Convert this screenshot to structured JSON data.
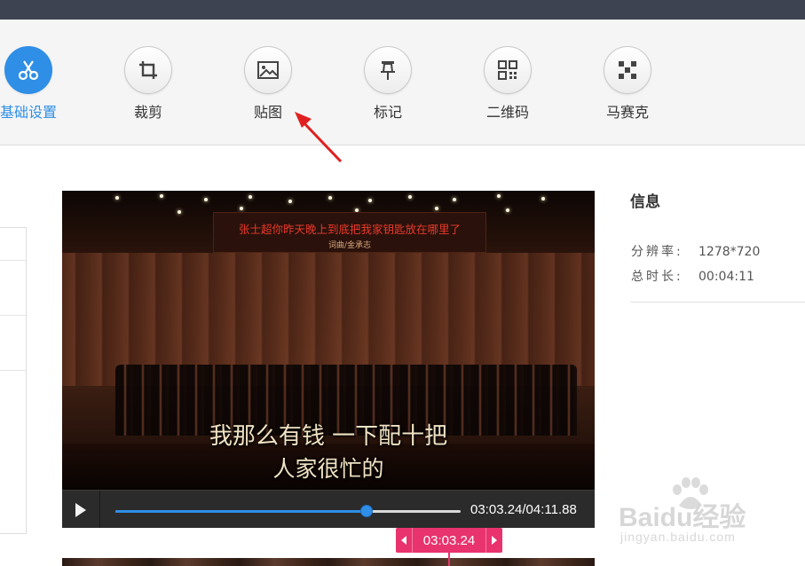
{
  "toolbar": {
    "tools": [
      {
        "label": "基础设置",
        "icon": "scissors-icon",
        "active": true
      },
      {
        "label": "裁剪",
        "icon": "crop-icon"
      },
      {
        "label": "贴图",
        "icon": "image-icon"
      },
      {
        "label": "标记",
        "icon": "pin-icon"
      },
      {
        "label": "二维码",
        "icon": "qrcode-icon"
      },
      {
        "label": "马赛克",
        "icon": "mosaic-icon"
      }
    ],
    "accent": "#2f8ee6"
  },
  "video": {
    "banner_title": "张士超你昨天晚上到底把我家钥匙放在哪里了",
    "banner_subtitle": "词曲/金承志",
    "subtitle_line1": "我那么有钱 一下配十把",
    "subtitle_line2": "人家很忙的",
    "time_display": "03:03.24/04:11.88",
    "progress_fraction": 0.7286
  },
  "timeline": {
    "marker_time": "03:03.24",
    "marker_color": "#e8336e"
  },
  "info": {
    "title": "信息",
    "resolution_label": "分辨率:",
    "resolution_value": "1278*720",
    "duration_label": "总时长:",
    "duration_value": "00:04:11"
  },
  "watermark": {
    "main": "Baidu经验",
    "sub": "jingyan.baidu.com"
  }
}
